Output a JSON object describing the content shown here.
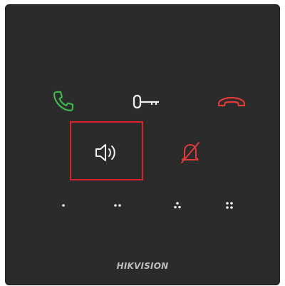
{
  "brand": {
    "name": "HIKVISION"
  },
  "buttons": {
    "call": {
      "icon": "phone-answer-icon",
      "color": "#3db84a"
    },
    "unlock": {
      "icon": "key-icon",
      "color": "#f2f2f2"
    },
    "hangup": {
      "icon": "phone-hangup-icon",
      "color": "#e03a3a"
    },
    "speaker": {
      "icon": "speaker-volume-icon",
      "color": "#f2f2f2",
      "highlighted": true
    },
    "mute": {
      "icon": "bell-off-icon",
      "color": "#e03a3a"
    }
  },
  "keypad": [
    {
      "icon": "one-dot-icon"
    },
    {
      "icon": "two-dots-icon"
    },
    {
      "icon": "three-dots-icon"
    },
    {
      "icon": "four-dots-icon"
    }
  ],
  "highlight_color": "#d8232a"
}
